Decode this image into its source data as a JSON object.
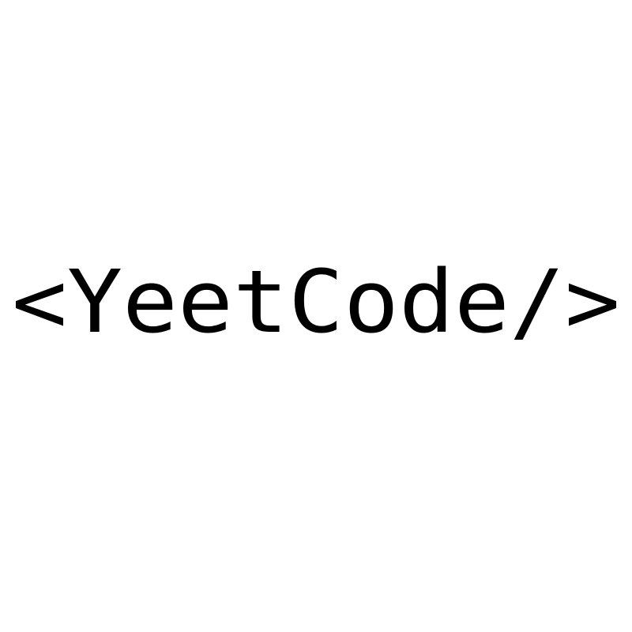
{
  "logo": {
    "text": "<YeetCode/>",
    "color": "#000000"
  },
  "background_color": "#ffffff"
}
